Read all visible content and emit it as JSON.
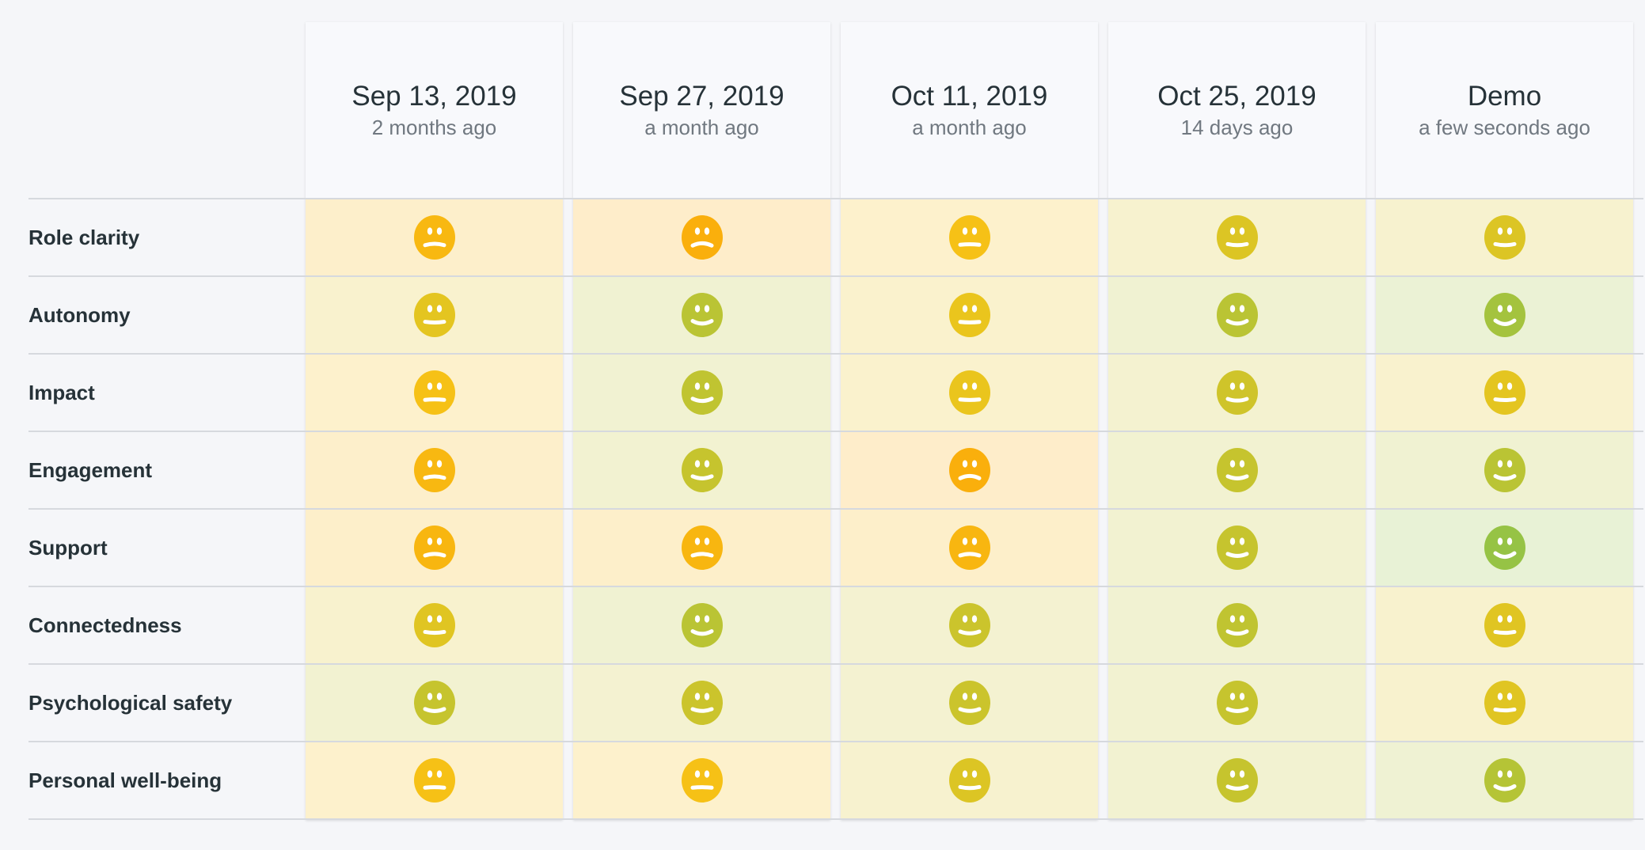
{
  "columns": [
    {
      "date": "Sep 13, 2019",
      "ago": "2 months ago"
    },
    {
      "date": "Sep 27, 2019",
      "ago": "a month ago"
    },
    {
      "date": "Oct 11, 2019",
      "ago": "a month ago"
    },
    {
      "date": "Oct 25, 2019",
      "ago": "14 days ago"
    },
    {
      "date": "Demo",
      "ago": "a few seconds ago"
    }
  ],
  "rows": [
    {
      "label": "Role clarity",
      "scores": [
        0.35,
        0.25,
        0.45,
        0.62,
        0.62
      ]
    },
    {
      "label": "Autonomy",
      "scores": [
        0.58,
        0.78,
        0.55,
        0.78,
        0.88
      ]
    },
    {
      "label": "Impact",
      "scores": [
        0.45,
        0.75,
        0.55,
        0.68,
        0.58
      ]
    },
    {
      "label": "Engagement",
      "scores": [
        0.35,
        0.72,
        0.25,
        0.72,
        0.78
      ]
    },
    {
      "label": "Support",
      "scores": [
        0.33,
        0.33,
        0.33,
        0.72,
        0.95
      ]
    },
    {
      "label": "Connectedness",
      "scores": [
        0.6,
        0.78,
        0.7,
        0.75,
        0.6
      ]
    },
    {
      "label": "Psychological safety",
      "scores": [
        0.72,
        0.7,
        0.7,
        0.72,
        0.6
      ]
    },
    {
      "label": "Personal well-being",
      "scores": [
        0.45,
        0.45,
        0.62,
        0.72,
        0.8
      ]
    }
  ],
  "face_icon": "mood-face-icon",
  "palette": {
    "low": "#ff9800",
    "mid": "#f5c518",
    "high": "#8bc34a"
  }
}
